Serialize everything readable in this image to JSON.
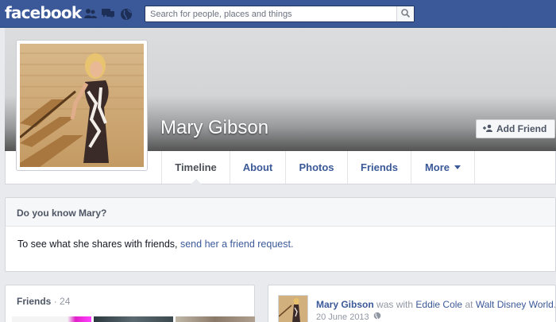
{
  "topbar": {
    "logo": "facebook",
    "search_placeholder": "Search for people, places and things",
    "icons": [
      "friend-requests-icon",
      "messages-icon",
      "notifications-globe-icon",
      "search-icon"
    ],
    "colors": {
      "bar": "#3b5998",
      "link": "#3b5998"
    }
  },
  "profile": {
    "name": "Mary Gibson",
    "add_friend_label": "Add Friend"
  },
  "nav": {
    "tabs": [
      {
        "label": "Timeline"
      },
      {
        "label": "About"
      },
      {
        "label": "Photos"
      },
      {
        "label": "Friends"
      },
      {
        "label": "More"
      }
    ],
    "active": "Timeline"
  },
  "know": {
    "title": "Do you know Mary?",
    "text": "To see what she shares with friends,",
    "link": "send her a friend request."
  },
  "friends": {
    "title": "Friends",
    "separator": "·",
    "count": "24"
  },
  "post": {
    "author": "Mary Gibson",
    "with_text": "was with",
    "tagged": "Eddie Cole",
    "at_text": "at",
    "place": "Walt Disney World",
    "suffix": ".",
    "date": "20 June 2013"
  }
}
